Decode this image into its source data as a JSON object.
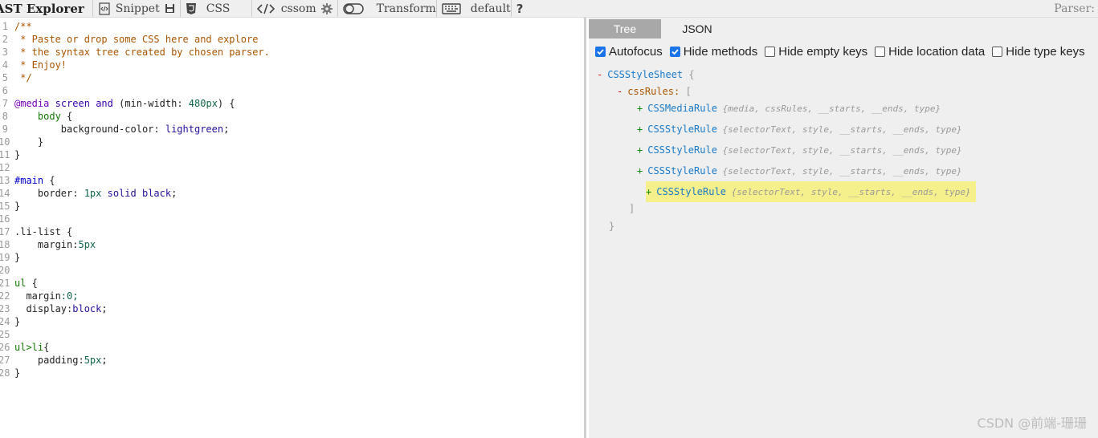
{
  "toolbar": {
    "title": "AST Explorer",
    "snippet": "Snippet",
    "language": "CSS",
    "parser_name": "cssom",
    "transform": "Transform",
    "keymap": "default",
    "parser_label": "Parser:"
  },
  "editor": {
    "lines": [
      {
        "n": "1",
        "t": "/**"
      },
      {
        "n": "2",
        "t": " * Paste or drop some CSS here and explore"
      },
      {
        "n": "3",
        "t": " * the syntax tree created by chosen parser."
      },
      {
        "n": "4",
        "t": " * Enjoy!"
      },
      {
        "n": "5",
        "t": " */"
      },
      {
        "n": "6",
        "t": ""
      },
      {
        "n": "7",
        "t": "@media screen and (min-width: 480px) {"
      },
      {
        "n": "8",
        "t": "    body {"
      },
      {
        "n": "9",
        "t": "        background-color: lightgreen;"
      },
      {
        "n": "10",
        "t": "    }"
      },
      {
        "n": "11",
        "t": "}"
      },
      {
        "n": "12",
        "t": ""
      },
      {
        "n": "13",
        "t": "#main {"
      },
      {
        "n": "14",
        "t": "    border: 1px solid black;"
      },
      {
        "n": "15",
        "t": "}"
      },
      {
        "n": "16",
        "t": ""
      },
      {
        "n": "17",
        "t": ".li-list {"
      },
      {
        "n": "18",
        "t": "    margin:5px"
      },
      {
        "n": "19",
        "t": "}"
      },
      {
        "n": "20",
        "t": ""
      },
      {
        "n": "21",
        "t": "ul {"
      },
      {
        "n": "22",
        "t": "  margin:0;"
      },
      {
        "n": "23",
        "t": "  display:block;"
      },
      {
        "n": "24",
        "t": "}"
      },
      {
        "n": "25",
        "t": ""
      },
      {
        "n": "26",
        "t": "ul>li{"
      },
      {
        "n": "27",
        "t": "    padding:5px;"
      },
      {
        "n": "28",
        "t": "}"
      }
    ]
  },
  "tabs": [
    "Tree",
    "JSON"
  ],
  "options": [
    {
      "label": "Autofocus",
      "checked": true
    },
    {
      "label": "Hide methods",
      "checked": true
    },
    {
      "label": "Hide empty keys",
      "checked": false
    },
    {
      "label": "Hide location data",
      "checked": false
    },
    {
      "label": "Hide type keys",
      "checked": false
    }
  ],
  "tree": {
    "root": {
      "toggle": "-",
      "name": "CSSStyleSheet",
      "brace": "{"
    },
    "rules_key": {
      "toggle": "-",
      "name": "cssRules:",
      "brace": "["
    },
    "children": [
      {
        "toggle": "+",
        "name": "CSSMediaRule",
        "summary": "{media, cssRules, __starts, __ends, type}"
      },
      {
        "toggle": "+",
        "name": "CSSStyleRule",
        "summary": "{selectorText, style, __starts, __ends, type}"
      },
      {
        "toggle": "+",
        "name": "CSSStyleRule",
        "summary": "{selectorText, style, __starts, __ends, type}"
      },
      {
        "toggle": "+",
        "name": "CSSStyleRule",
        "summary": "{selectorText, style, __starts, __ends, type}"
      },
      {
        "toggle": "+",
        "name": "CSSStyleRule",
        "summary": "{selectorText, style, __starts, __ends, type}"
      }
    ],
    "close_bracket": "]",
    "close_brace": "}"
  },
  "watermark": "CSDN @前端-珊珊"
}
